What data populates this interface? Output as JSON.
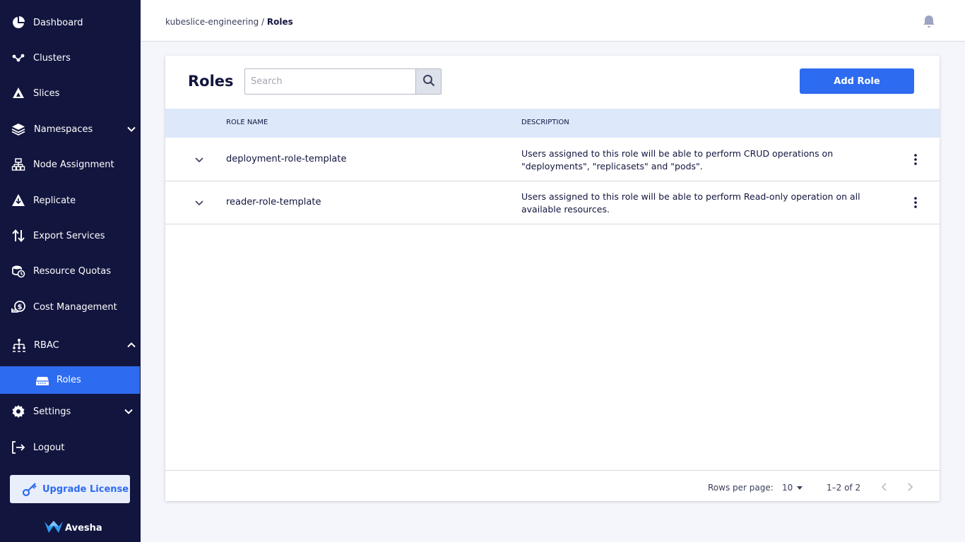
{
  "sidebar": {
    "items": [
      {
        "label": "Dashboard",
        "icon": "pie-chart-icon"
      },
      {
        "label": "Clusters",
        "icon": "network-icon"
      },
      {
        "label": "Slices",
        "icon": "slices-icon"
      },
      {
        "label": "Namespaces",
        "icon": "layers-icon",
        "expandable": true
      },
      {
        "label": "Node Assignment",
        "icon": "node-tree-icon"
      },
      {
        "label": "Replicate",
        "icon": "replicate-icon"
      },
      {
        "label": "Export Services",
        "icon": "arrows-up-down-icon"
      },
      {
        "label": "Resource Quotas",
        "icon": "quota-icon"
      },
      {
        "label": "Cost Management",
        "icon": "coins-icon"
      },
      {
        "label": "RBAC",
        "icon": "rbac-hierarchy-icon",
        "expanded": true
      },
      {
        "label": "Settings",
        "icon": "gear-icon",
        "expandable": true
      },
      {
        "label": "Logout",
        "icon": "logout-icon"
      }
    ],
    "sub_item": {
      "label": "Roles",
      "icon": "roles-icon"
    },
    "upgrade_label": "Upgrade License",
    "brand": "Avesha"
  },
  "header": {
    "breadcrumb_parent": "kubeslice-engineering",
    "breadcrumb_sep": "/",
    "breadcrumb_current": "Roles"
  },
  "page": {
    "title": "Roles",
    "search_placeholder": "Search",
    "add_button": "Add Role",
    "columns": {
      "name": "ROLE NAME",
      "description": "DESCRIPTION"
    },
    "rows": [
      {
        "name": "deployment-role-template",
        "description": "Users assigned to this role will be able to perform CRUD operations on \"deployments\", \"replicasets\" and \"pods\"."
      },
      {
        "name": "reader-role-template",
        "description": "Users assigned to this role will be able to perform Read-only operation on all available resources."
      }
    ],
    "pagination": {
      "rows_per_page_label": "Rows per page:",
      "rows_per_page": "10",
      "range": "1–2 of 2"
    }
  },
  "colors": {
    "sidebar_bg": "#12153e",
    "accent": "#2d6bf0",
    "table_header_bg": "#dde8fb"
  }
}
